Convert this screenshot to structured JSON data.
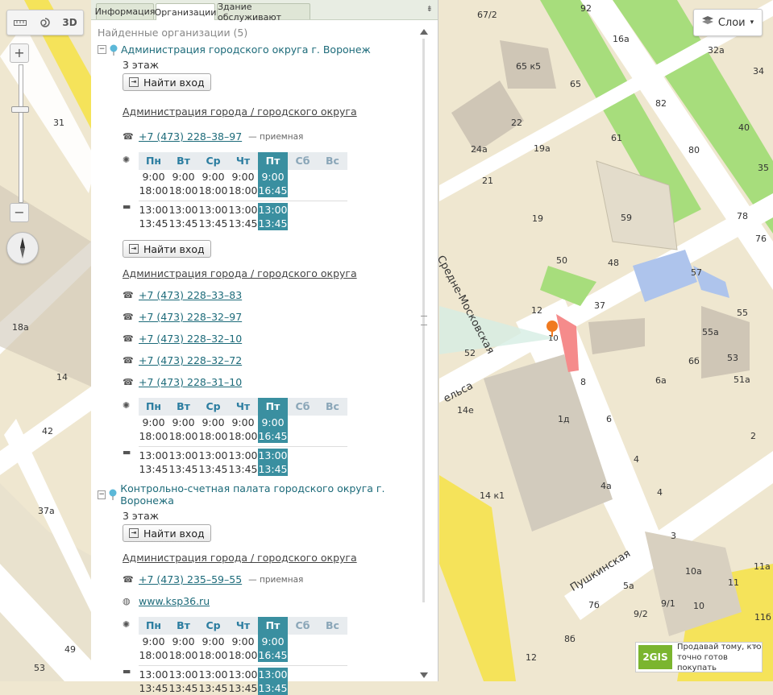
{
  "map": {
    "toolbar": {
      "btn_3d": "3D"
    },
    "layers_label": "Слои",
    "ad": {
      "logo": "2GIS",
      "text_line1": "Продавай тому, кто",
      "text_line2": "точно готов покупать"
    },
    "marker_label": "10",
    "streets": [
      "Средне-Московская",
      "Пушкинская",
      "ельса"
    ],
    "house_numbers": [
      "67/2",
      "92",
      "16а",
      "32а",
      "65 к5",
      "65",
      "34",
      "82",
      "22",
      "19а",
      "61",
      "40",
      "80",
      "24а",
      "35",
      "21",
      "59",
      "78",
      "19",
      "76",
      "50",
      "48",
      "57",
      "12",
      "37",
      "55",
      "55а",
      "10",
      "53",
      "6б",
      "52",
      "51а",
      "8",
      "6а",
      "14",
      "14е",
      "1д",
      "6",
      "2",
      "42",
      "4",
      "18а",
      "37а",
      "14 к1",
      "4а",
      "4",
      "3",
      "5а",
      "10а",
      "11",
      "11а",
      "7б",
      "9/1",
      "10",
      "9/2",
      "49",
      "53",
      "8б",
      "11б",
      "31",
      "12"
    ]
  },
  "panel": {
    "tabs": [
      "Информация",
      "Организации",
      "Здание обслуживают"
    ],
    "active_tab": 1,
    "found_label": "Найденные организации (5)",
    "enter_label": "Найти вход",
    "days": [
      "Пн",
      "Вт",
      "Ср",
      "Чт",
      "Пт",
      "Сб",
      "Вс"
    ],
    "orgs": [
      {
        "name": "Администрация городского округа г. Воронеж",
        "floor": "3 этаж",
        "blocks": [
          {
            "rubric": "Администрация города / городского округа",
            "phones": [
              {
                "number": "+7 (473) 228–38–97",
                "note": "— приемная"
              }
            ],
            "hours": {
              "open": [
                "9:00",
                "9:00",
                "9:00",
                "9:00",
                "9:00"
              ],
              "close": [
                "18:00",
                "18:00",
                "18:00",
                "18:00",
                "16:45"
              ],
              "lunch_start": [
                "13:00",
                "13:00",
                "13:00",
                "13:00",
                "13:00"
              ],
              "lunch_end": [
                "13:45",
                "13:45",
                "13:45",
                "13:45",
                "13:45"
              ]
            }
          },
          {
            "rubric": "Администрация города / городского округа",
            "phones": [
              {
                "number": "+7 (473) 228–33–83",
                "note": ""
              },
              {
                "number": "+7 (473) 228–32–97",
                "note": ""
              },
              {
                "number": "+7 (473) 228–32–10",
                "note": ""
              },
              {
                "number": "+7 (473) 228–32–72",
                "note": ""
              },
              {
                "number": "+7 (473) 228–31–10",
                "note": ""
              }
            ],
            "hours": {
              "open": [
                "9:00",
                "9:00",
                "9:00",
                "9:00",
                "9:00"
              ],
              "close": [
                "18:00",
                "18:00",
                "18:00",
                "18:00",
                "16:45"
              ],
              "lunch_start": [
                "13:00",
                "13:00",
                "13:00",
                "13:00",
                "13:00"
              ],
              "lunch_end": [
                "13:45",
                "13:45",
                "13:45",
                "13:45",
                "13:45"
              ]
            }
          }
        ]
      },
      {
        "name": "Контрольно-счетная палата городского округа г. Воронежа",
        "floor": "3 этаж",
        "blocks": [
          {
            "rubric": "Администрация города / городского округа",
            "phones": [
              {
                "number": "+7 (473) 235–59–55",
                "note": "— приемная"
              }
            ],
            "website": "www.ksp36.ru",
            "hours": {
              "open": [
                "9:00",
                "9:00",
                "9:00",
                "9:00",
                "9:00"
              ],
              "close": [
                "18:00",
                "18:00",
                "18:00",
                "18:00",
                "16:45"
              ],
              "lunch_start": [
                "13:00",
                "13:00",
                "13:00",
                "13:00",
                "13:00"
              ],
              "lunch_end": [
                "13:45",
                "13:45",
                "13:45",
                "13:45",
                "13:45"
              ]
            }
          }
        ]
      }
    ]
  }
}
